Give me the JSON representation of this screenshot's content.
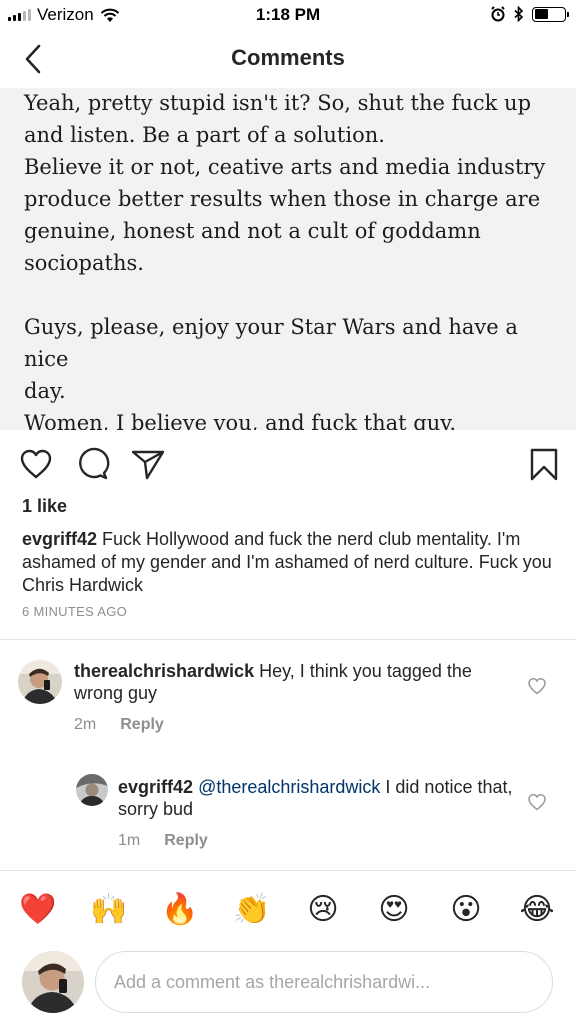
{
  "status_bar": {
    "carrier": "Verizon",
    "time": "1:18 PM",
    "battery_level": 0.45
  },
  "nav": {
    "title": "Comments",
    "back_icon": "chevron-left-icon"
  },
  "post": {
    "paragraphs": [
      "Yeah, pretty stupid isn't it? So,  shut the fuck up\nand listen. Be a part of a solution.\nBelieve it or not, ceative arts and media industry\nproduce better results when those in charge are\ngenuine, honest and not a cult of goddamn\nsociopaths.",
      "Guys, please, enjoy your Star Wars and have a nice\nday.\nWomen, I believe you, and fuck that guy."
    ]
  },
  "actions": {
    "icons": [
      "heart-icon",
      "comment-icon",
      "share-icon",
      "bookmark-icon"
    ]
  },
  "likes": "1 like",
  "caption": {
    "username": "evgriff42",
    "text": " Fuck Hollywood and fuck the nerd club mentality. I'm ashamed of my gender and I'm ashamed of nerd culture. Fuck you Chris Hardwick",
    "time": "6 MINUTES AGO"
  },
  "comments": [
    {
      "username": "therealchrishardwick",
      "text": " Hey, I think you tagged the wrong guy",
      "time": "2m",
      "reply_label": "Reply"
    },
    {
      "username": "evgriff42",
      "mention": "@therealchrishardwick",
      "text": " I did notice that, sorry bud",
      "time": "1m",
      "reply_label": "Reply"
    }
  ],
  "emoji_bar": [
    "❤️",
    "🙌",
    "🔥",
    "👏",
    "😢",
    "😍",
    "😮",
    "😂"
  ],
  "input": {
    "placeholder": "Add a comment as therealchrishardwi..."
  },
  "colors": {
    "post_bg": "#f2f2f2",
    "mention": "#003569",
    "muted": "#8e8e8e"
  }
}
